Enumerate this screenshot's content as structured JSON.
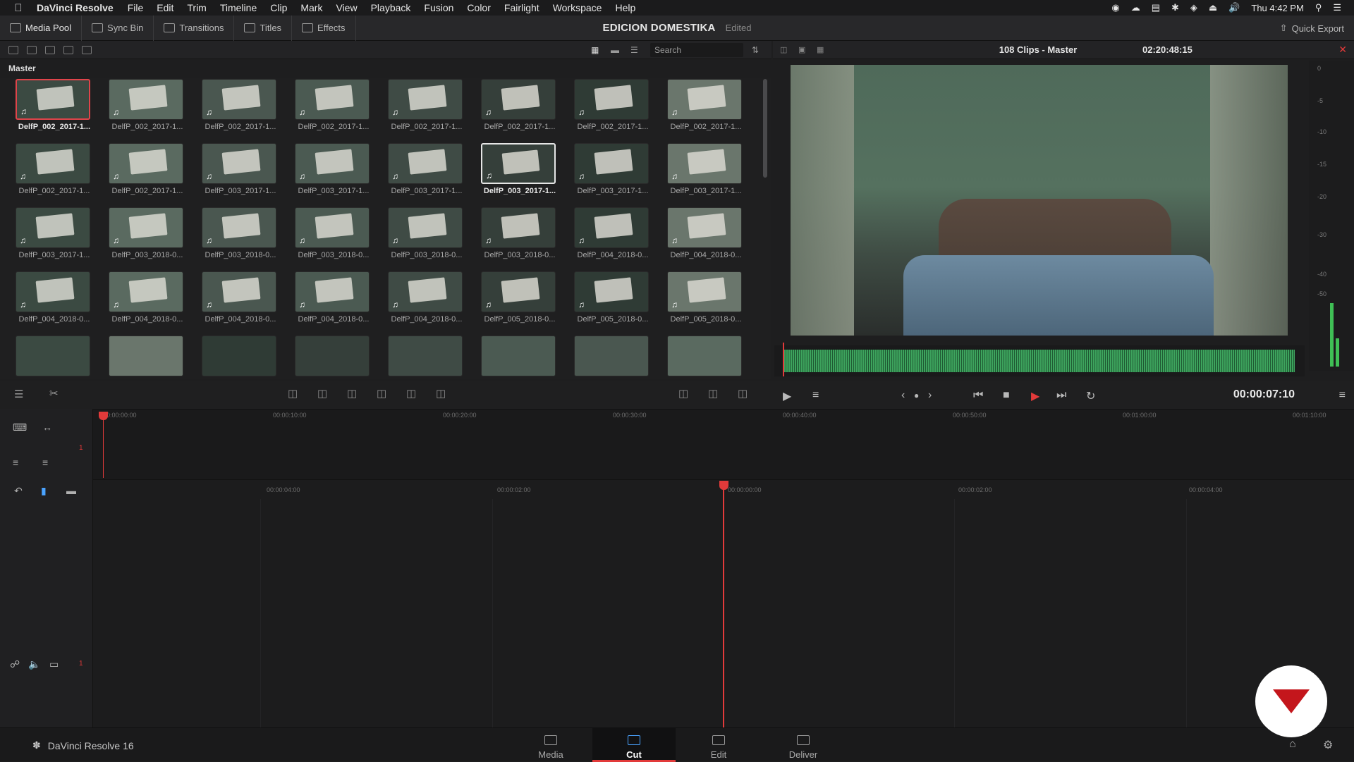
{
  "menubar": {
    "app": "DaVinci Resolve",
    "items": [
      "File",
      "Edit",
      "Trim",
      "Timeline",
      "Clip",
      "Mark",
      "View",
      "Playback",
      "Fusion",
      "Color",
      "Fairlight",
      "Workspace",
      "Help"
    ],
    "clock": "Thu 4:42 PM"
  },
  "toolbar": {
    "media_pool": "Media Pool",
    "sync_bin": "Sync Bin",
    "transitions": "Transitions",
    "titles": "Titles",
    "effects": "Effects",
    "project_title": "EDICION DOMESTIKA",
    "project_status": "Edited",
    "quick_export": "Quick Export"
  },
  "pool": {
    "search_placeholder": "Search",
    "bin": "Master",
    "clips": [
      "DelfP_002_2017-1...",
      "DelfP_002_2017-1...",
      "DelfP_002_2017-1...",
      "DelfP_002_2017-1...",
      "DelfP_002_2017-1...",
      "DelfP_002_2017-1...",
      "DelfP_002_2017-1...",
      "DelfP_002_2017-1...",
      "DelfP_002_2017-1...",
      "DelfP_002_2017-1...",
      "DelfP_003_2017-1...",
      "DelfP_003_2017-1...",
      "DelfP_003_2017-1...",
      "DelfP_003_2017-1...",
      "DelfP_003_2017-1...",
      "DelfP_003_2017-1...",
      "DelfP_003_2017-1...",
      "DelfP_003_2018-0...",
      "DelfP_003_2018-0...",
      "DelfP_003_2018-0...",
      "DelfP_003_2018-0...",
      "DelfP_003_2018-0...",
      "DelfP_004_2018-0...",
      "DelfP_004_2018-0...",
      "DelfP_004_2018-0...",
      "DelfP_004_2018-0...",
      "DelfP_004_2018-0...",
      "DelfP_004_2018-0...",
      "DelfP_004_2018-0...",
      "DelfP_005_2018-0...",
      "DelfP_005_2018-0...",
      "DelfP_005_2018-0..."
    ]
  },
  "viewer": {
    "title": "108 Clips - Master",
    "source_tc": "02:20:48:15",
    "timecode": "00:00:07:10",
    "db_labels": [
      "0",
      "-5",
      "-10",
      "-15",
      "-20",
      "-30",
      "-40",
      "-50"
    ]
  },
  "timeline": {
    "ruler_upper": [
      "00:00:00:00",
      "00:00:10:00",
      "00:00:20:00",
      "00:00:30:00",
      "00:00:40:00",
      "00:00:50:00",
      "00:01:00:00",
      "00:01:10:00"
    ],
    "ruler_lower": [
      "00:00:04:00",
      "00:00:02:00",
      "00:00:00:00",
      "00:00:02:00",
      "00:00:04:00"
    ],
    "track_num": "1"
  },
  "footer": {
    "brand": "DaVinci Resolve 16",
    "pages": [
      "Media",
      "Cut",
      "Edit",
      "Deliver"
    ]
  }
}
